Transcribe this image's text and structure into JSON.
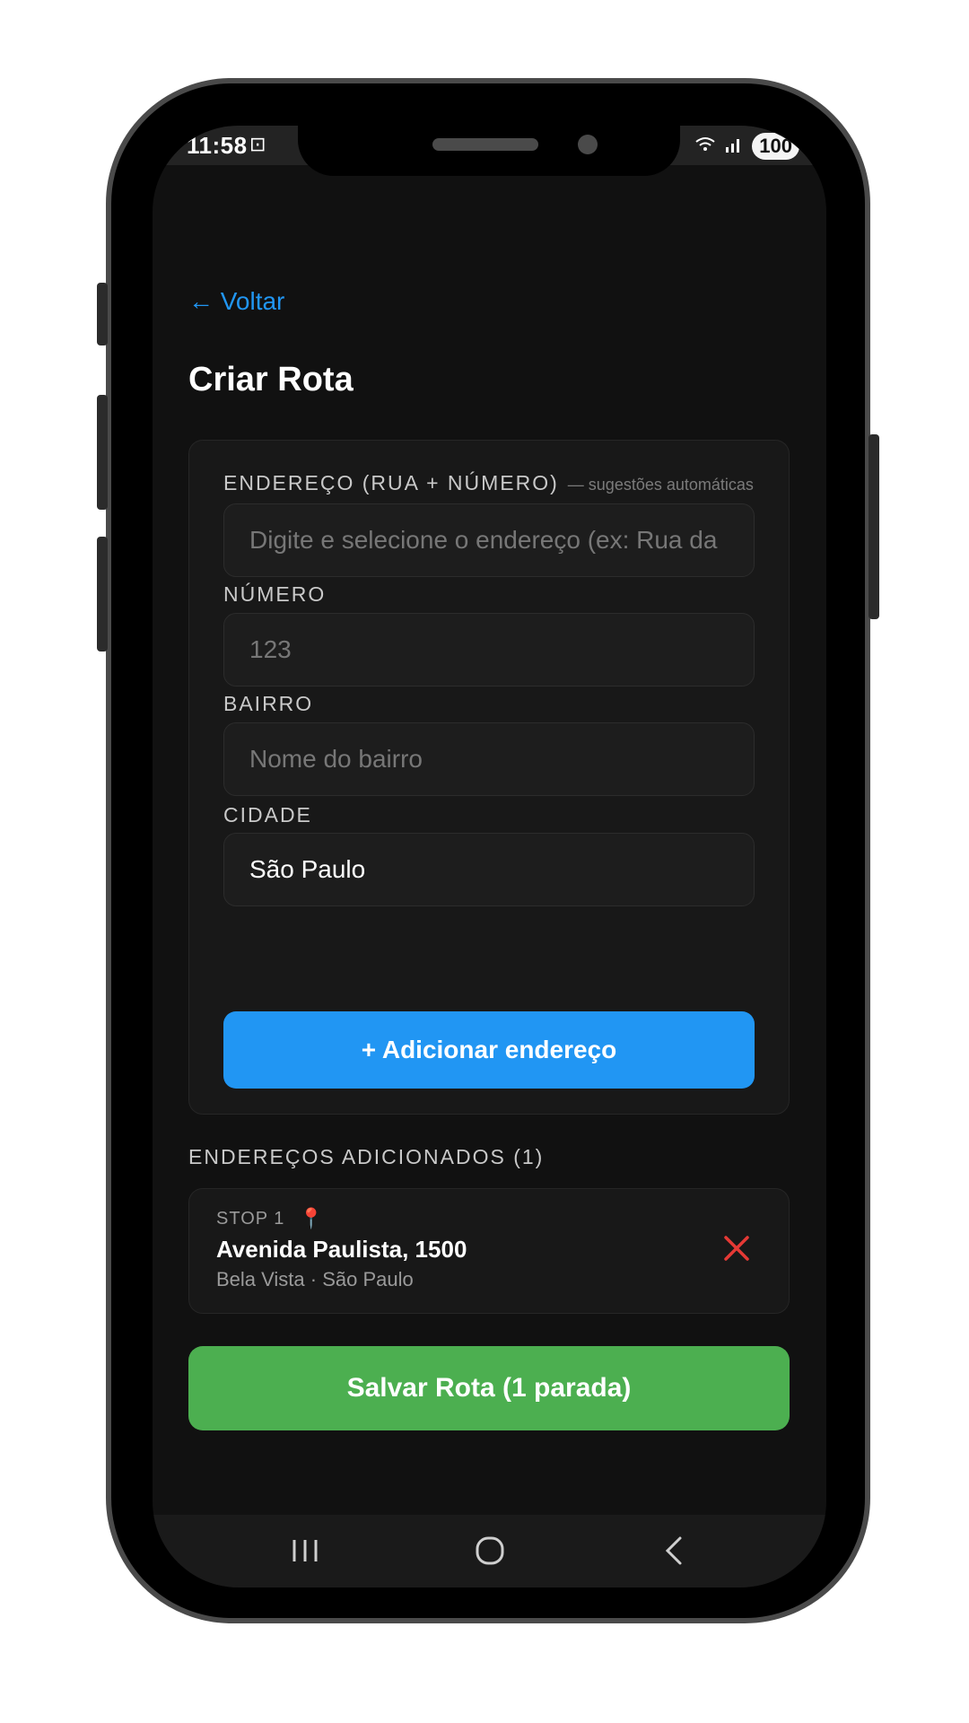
{
  "status": {
    "time": "11:58",
    "battery": "100"
  },
  "header": {
    "back_label": "← Voltar",
    "title": "Criar Rota"
  },
  "form": {
    "address_label": "ENDEREÇO (RUA + NÚMERO)",
    "address_hint": "— sugestões automáticas",
    "address_placeholder": "Digite e selecione o endereço (ex: Rua da",
    "number_label": "NÚMERO",
    "number_placeholder": "123",
    "district_label": "BAIRRO",
    "district_placeholder": "Nome do bairro",
    "city_label": "CIDADE",
    "city_value": "São Paulo",
    "add_button": "+ Adicionar endereço"
  },
  "added": {
    "section_label": "ENDEREÇOS ADICIONADOS (1)",
    "stops": [
      {
        "label": "STOP 1",
        "address": "Avenida Paulista, 1500",
        "sub": "Bela Vista · São Paulo"
      }
    ]
  },
  "save_button": "Salvar Rota (1 parada)",
  "colors": {
    "accent": "#2196f3",
    "save": "#4caf50",
    "remove": "#e53935",
    "background": "#111111"
  }
}
